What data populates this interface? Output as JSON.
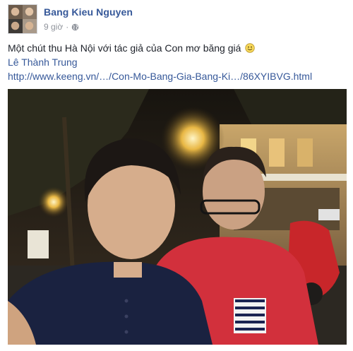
{
  "post": {
    "author": "Bang Kieu Nguyen",
    "timestamp": "9 giờ",
    "separator": "·",
    "privacy_icon": "globe-icon",
    "text": "Một chút thu Hà Nội với tác giả của Con mơ băng giá",
    "emoji": "smiley-emoji-icon",
    "tagged_person": "Lê Thành Trung",
    "link": "http://www.keeng.vn/…/Con-Mo-Bang-Gia-Bang-Ki…/86XYIBVG.html"
  },
  "colors": {
    "author_link": "#365899",
    "meta": "#90949c",
    "text": "#1d2129"
  },
  "photo": {
    "description_icon": "photo-selfie"
  }
}
